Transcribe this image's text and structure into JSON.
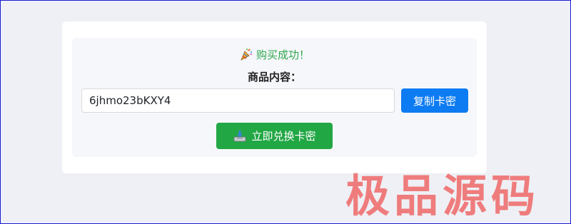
{
  "result": {
    "success_icon": "party-popper-icon",
    "success_text": "购买成功！",
    "content_title": "商品内容：",
    "code_value": "6jhmo23bKXY4",
    "copy_label": "复制卡密",
    "redeem_icon": "inbox-tray-icon",
    "redeem_label": "立即兑换卡密"
  },
  "watermark": {
    "text": "极品源码"
  },
  "colors": {
    "page_bg": "#eef0f5",
    "success_green": "#2fa84f",
    "copy_blue": "#0d7bf2",
    "redeem_green": "#22a745",
    "watermark_red": "#f07373"
  }
}
